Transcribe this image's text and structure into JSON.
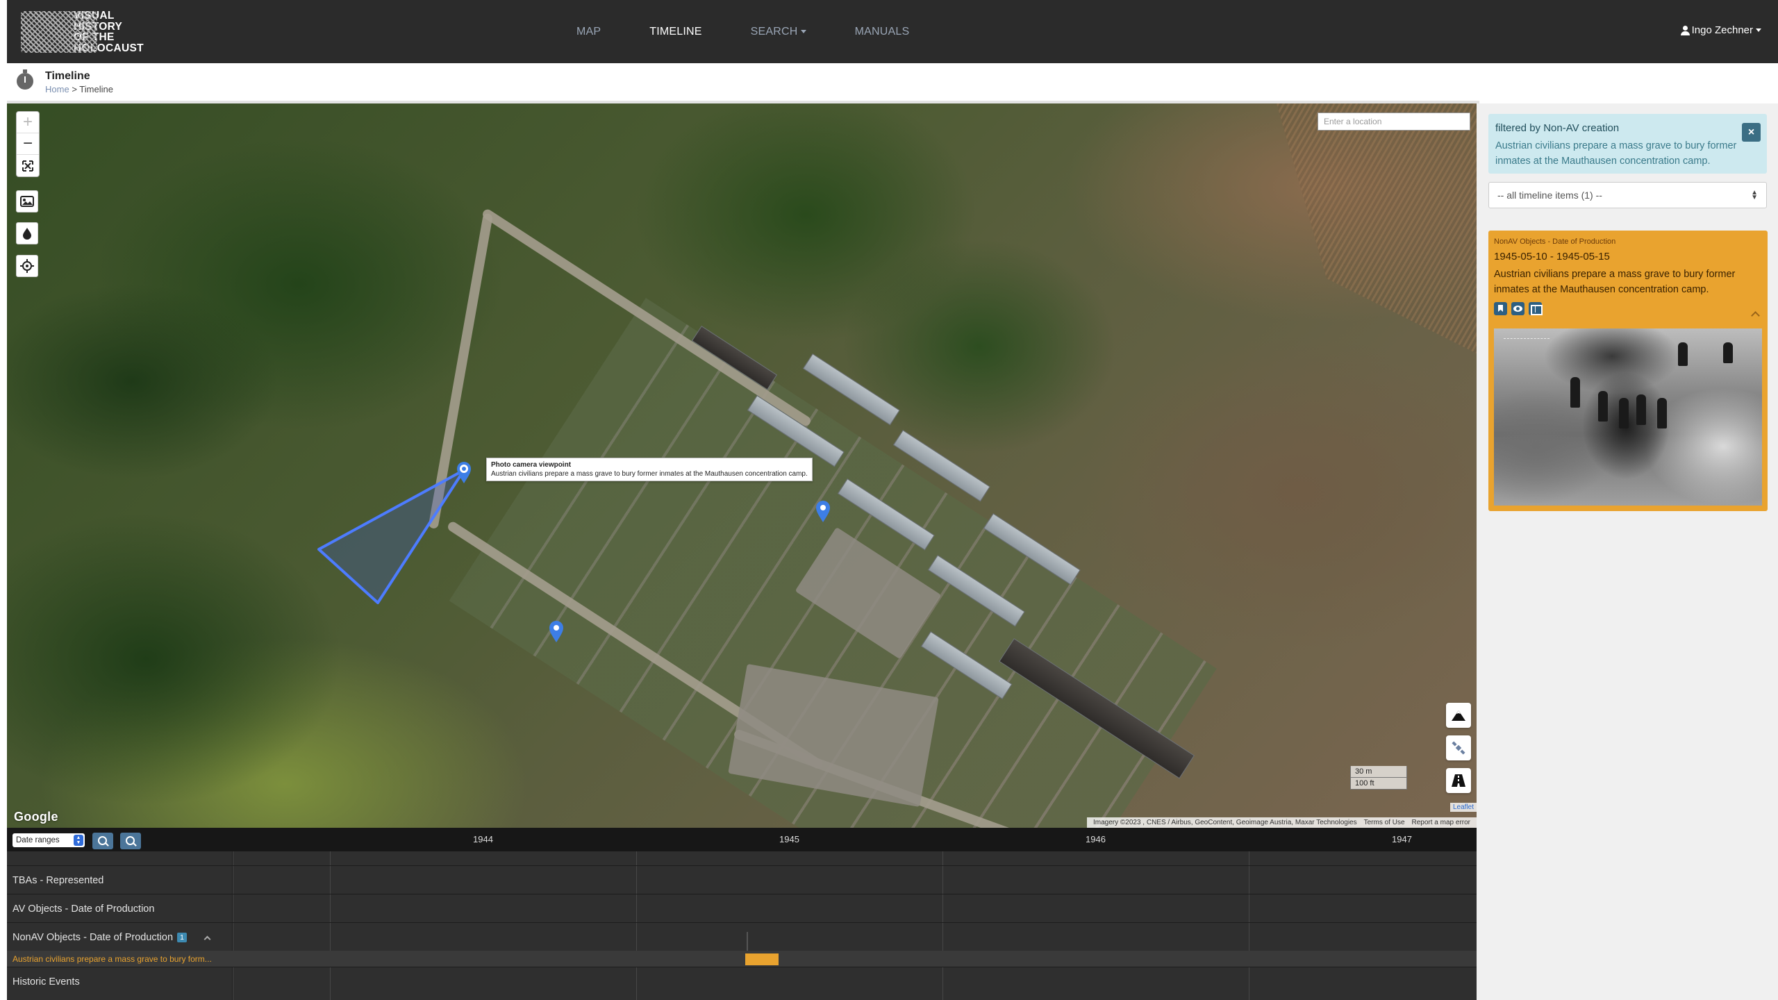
{
  "nav": {
    "logo_text": "VISUAL\nHISTORY\nOF THE\nHOLOCAUST",
    "links": [
      "MAP",
      "TIMELINE",
      "SEARCH",
      "MANUALS"
    ],
    "active": "TIMELINE",
    "user": "Ingo Zechner"
  },
  "page": {
    "title": "Timeline",
    "breadcrumb_home": "Home",
    "breadcrumb_sep": ">",
    "breadcrumb_current": "Timeline"
  },
  "map": {
    "location_placeholder": "Enter a location",
    "tooltip_title": "Photo camera viewpoint",
    "tooltip_text": "Austrian civilians prepare a mass grave to bury former inmates at the Mauthausen concentration camp.",
    "scale_m": "30 m",
    "scale_ft": "100 ft",
    "google": "Google",
    "leaflet": "Leaflet",
    "attribution": "Imagery ©2023 , CNES / Airbus, GeoContent, Geoimage Austria, Maxar Technologies",
    "terms": "Terms of Use",
    "report": "Report a map error",
    "controls": [
      "zoom-in-icon",
      "zoom-out-icon",
      "fit-bounds-icon",
      "image-layer-icon",
      "opacity-drop-icon",
      "locate-icon"
    ],
    "right_controls": [
      "mountain-icon",
      "satellite-icon",
      "road-icon"
    ]
  },
  "sidebar": {
    "filter_title": "filtered by Non-AV creation",
    "filter_desc": "Austrian civilians prepare a mass grave to bury former inmates at the Mauthausen concentration camp.",
    "close_label": "×",
    "select_value": "-- all timeline items (1) --",
    "card": {
      "category": "NonAV Objects - Date of Production",
      "date": "1945-05-10 - 1945-05-15",
      "description": "Austrian civilians prepare a mass grave to bury former inmates at the Mauthausen concentration camp.",
      "color": "#e9a32f"
    }
  },
  "timeline": {
    "range_select": "Date ranges",
    "years": [
      "1944",
      "1945",
      "1946",
      "1947"
    ],
    "rows": [
      {
        "label": "TBAs - Represented"
      },
      {
        "label": "AV Objects - Date of Production"
      },
      {
        "label": "NonAV Objects - Date of Production",
        "count": "1"
      },
      {
        "label": "Historic Events"
      }
    ],
    "sub_item": "Austrian civilians prepare a mass grave to bury form...",
    "accent": "#e9a32f"
  }
}
